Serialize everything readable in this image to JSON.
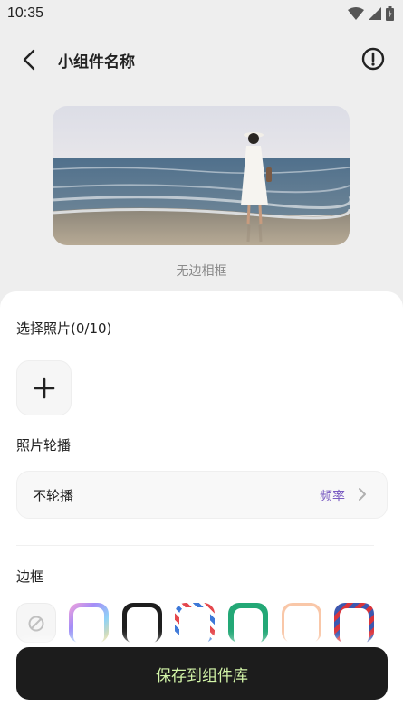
{
  "status_bar": {
    "time": "10:35"
  },
  "header": {
    "title": "小组件名称"
  },
  "preview": {
    "caption": "无边相框"
  },
  "select_photo": {
    "label": "选择照片(0/10)"
  },
  "carousel": {
    "label": "照片轮播",
    "value": "不轮播",
    "frequency_label": "频率"
  },
  "frames": {
    "label": "边框",
    "items": [
      "no-frame",
      "gradient-frame",
      "black-frame",
      "stripe-frame",
      "green-dotted-frame",
      "peach-frame",
      "red-blue-frame"
    ]
  },
  "save_button": {
    "label": "保存到组件库"
  },
  "colors": {
    "accent": "#7a5cc2",
    "save_bg": "#1c1c1c",
    "save_text": "#d3f5a8"
  }
}
